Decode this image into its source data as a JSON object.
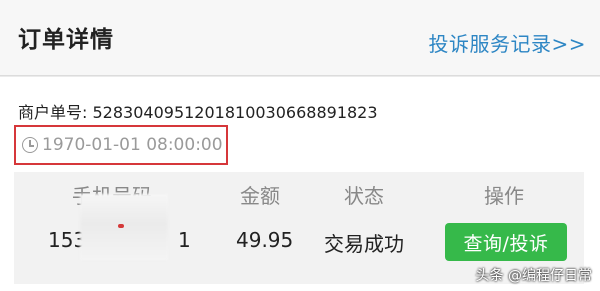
{
  "header": {
    "title": "订单详情",
    "link_label": "投诉服务记录>>"
  },
  "order": {
    "merchant_label": "商户单号:",
    "merchant_number": "5283040951201810030668891823",
    "time": "1970-01-01 08:00:00",
    "time_icon": "clock-icon"
  },
  "table": {
    "headers": [
      "手机号码",
      "金额",
      "状态",
      "操作"
    ],
    "row": {
      "phone_prefix": "153",
      "phone_suffix": "1",
      "amount": "49.95",
      "status": "交易成功",
      "action_label": "查询/投诉"
    }
  },
  "watermark": "头条 @编程仔日常",
  "colors": {
    "link": "#2d86c4",
    "highlight_border": "#d6373a",
    "action_button": "#36b94a"
  }
}
